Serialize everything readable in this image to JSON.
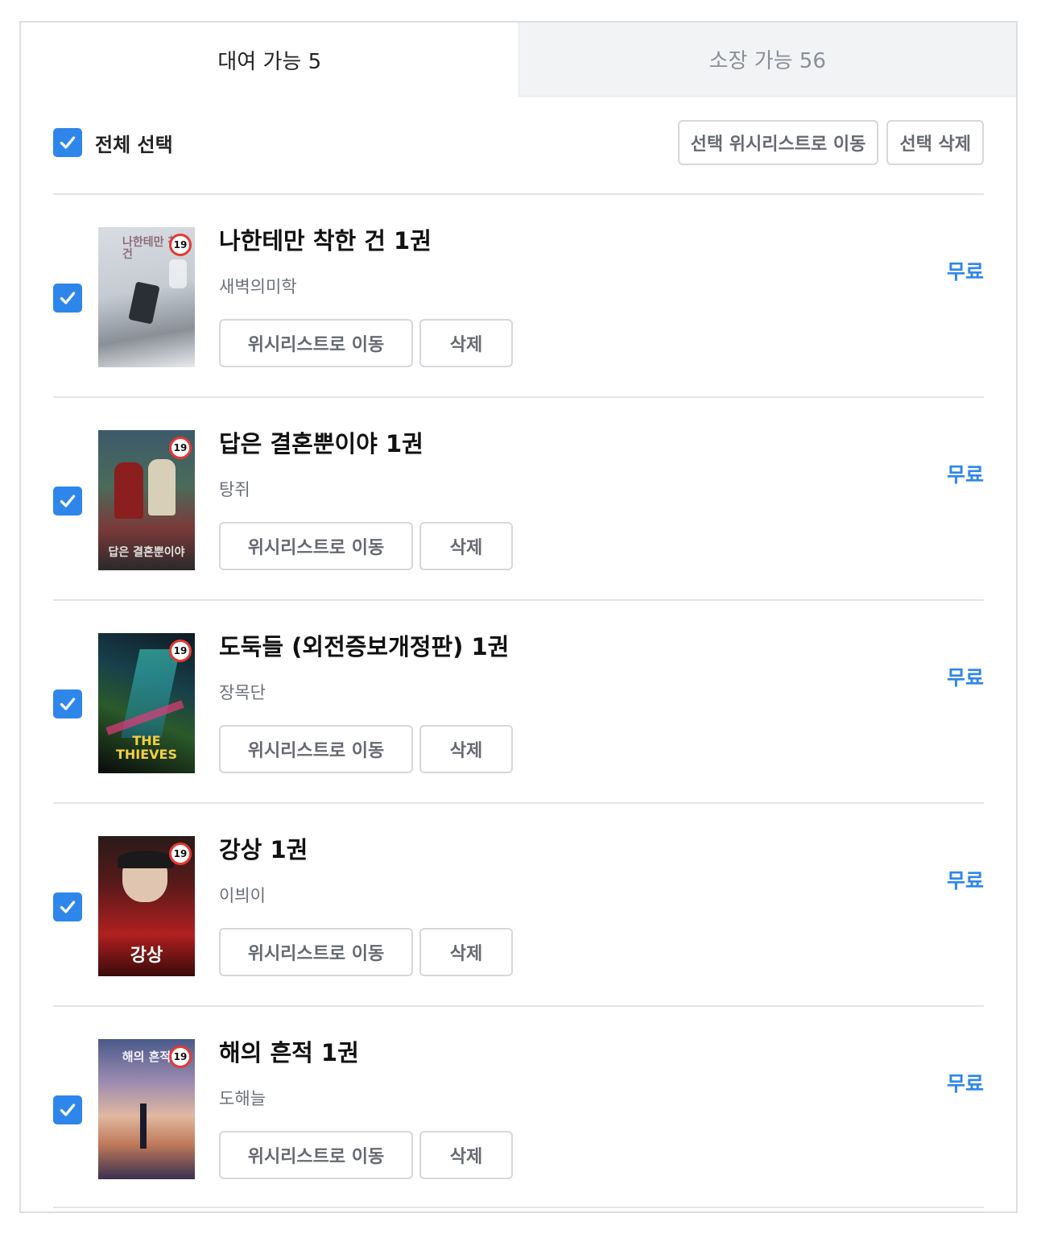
{
  "tabs": [
    {
      "label": "대여 가능 5",
      "active": true
    },
    {
      "label": "소장 가능 56",
      "active": false
    }
  ],
  "toolbar": {
    "select_all_label": "전체 선택",
    "select_all_checked": true,
    "move_selected_label": "선택 위시리스트로 이동",
    "delete_selected_label": "선택 삭제"
  },
  "books": [
    {
      "title": "나한테만 착한 건 1권",
      "author": "새벽의미학",
      "price": "무료",
      "wish_label": "위시리스트로 이동",
      "delete_label": "삭제",
      "checked": true,
      "age_rating": "19",
      "cover_text": "나한테만 착한 건"
    },
    {
      "title": "답은 결혼뿐이야 1권",
      "author": "탕쥐",
      "price": "무료",
      "wish_label": "위시리스트로 이동",
      "delete_label": "삭제",
      "checked": true,
      "age_rating": "19",
      "cover_text": "답은 결혼뿐이야"
    },
    {
      "title": "도둑들 (외전증보개정판) 1권",
      "author": "장목단",
      "price": "무료",
      "wish_label": "위시리스트로 이동",
      "delete_label": "삭제",
      "checked": true,
      "age_rating": "19",
      "cover_text": "THE THIEVES"
    },
    {
      "title": "강상 1권",
      "author": "이븨이",
      "price": "무료",
      "wish_label": "위시리스트로 이동",
      "delete_label": "삭제",
      "checked": true,
      "age_rating": "19",
      "cover_text": "강상"
    },
    {
      "title": "해의 흔적 1권",
      "author": "도해늘",
      "price": "무료",
      "wish_label": "위시리스트로 이동",
      "delete_label": "삭제",
      "checked": true,
      "age_rating": "19",
      "cover_text": "해의 흔적"
    }
  ],
  "colors": {
    "accent": "#2f86ea",
    "age_badge": "#e53935",
    "border": "#dcdee2",
    "inactive_tab_bg": "#f2f3f5"
  },
  "icons": {
    "checkbox": "check-icon",
    "age_badge": "age-19-badge"
  }
}
